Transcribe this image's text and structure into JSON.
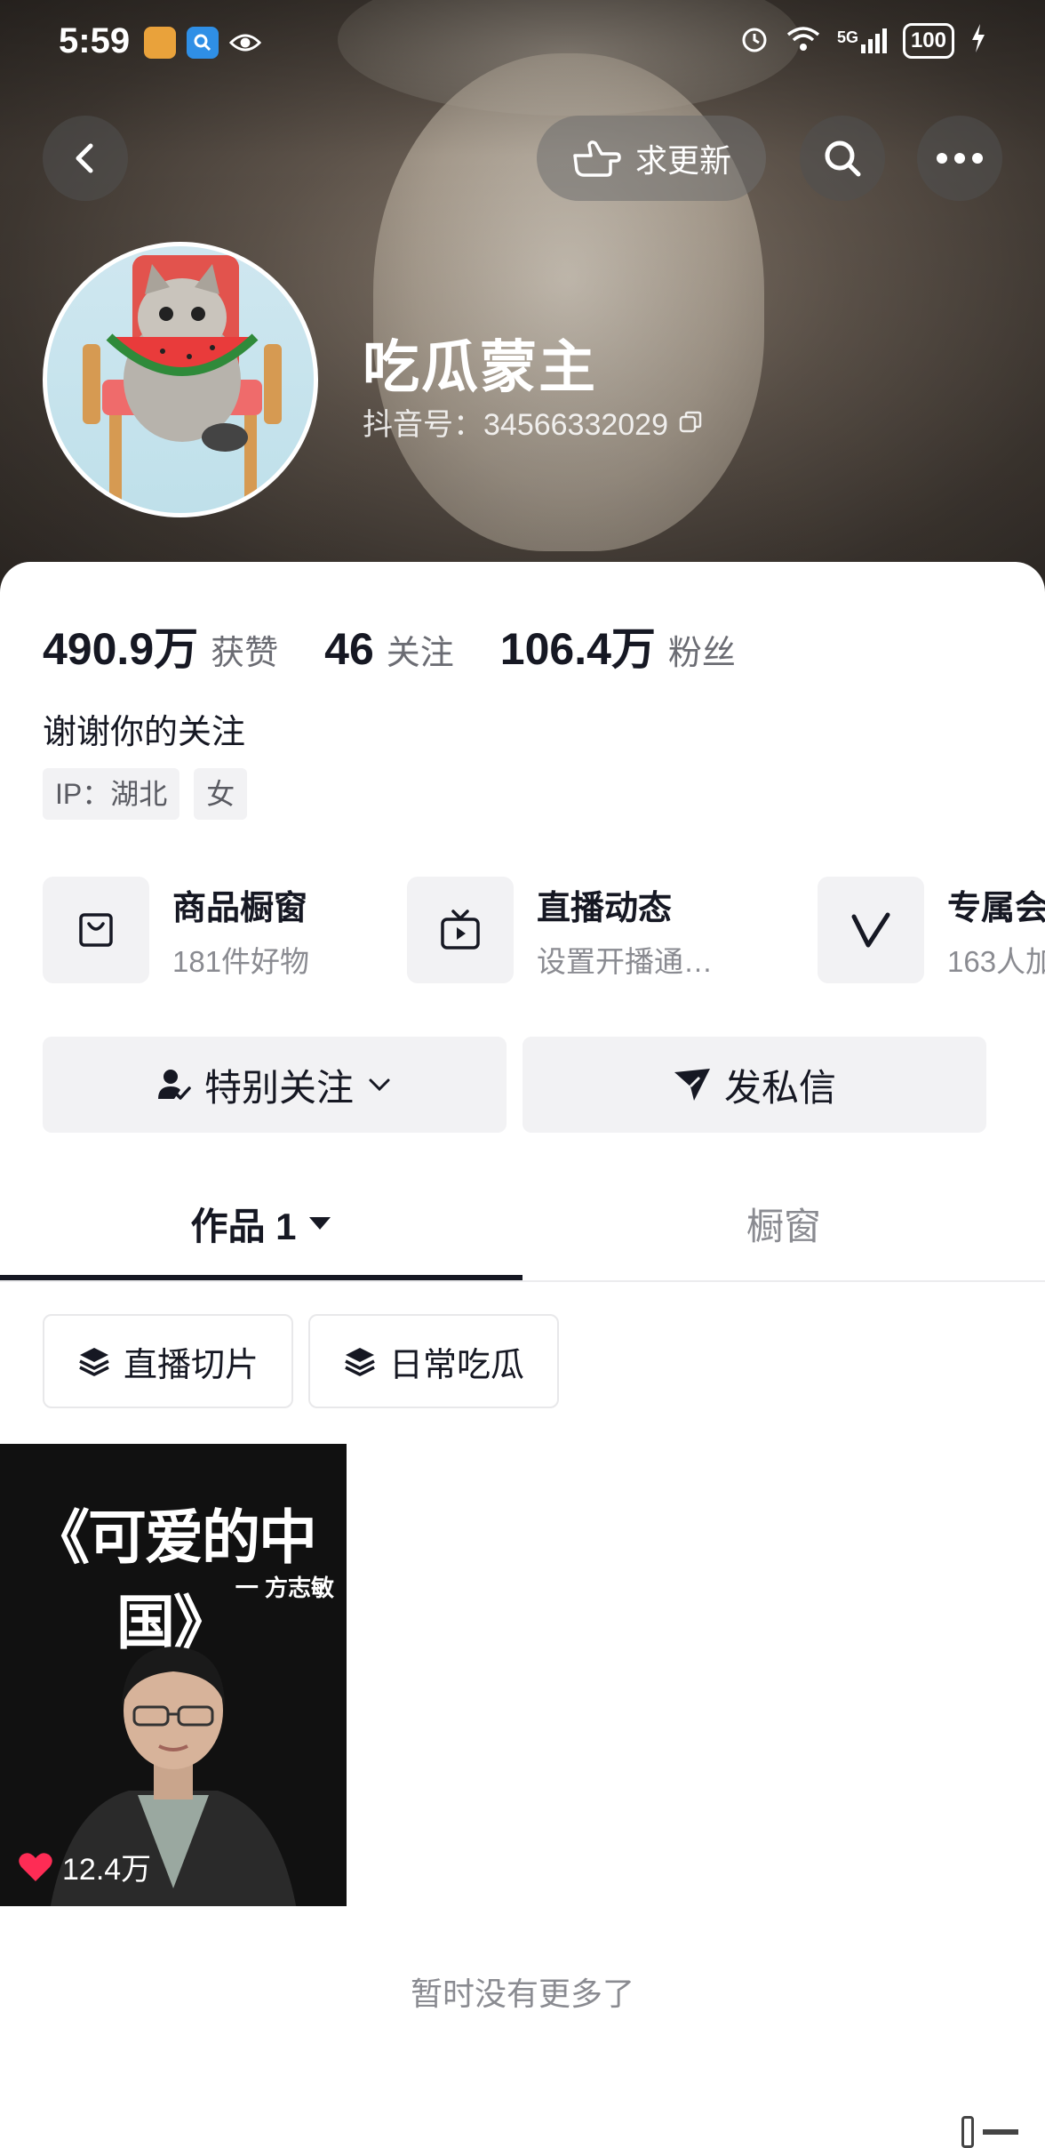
{
  "status_bar": {
    "time": "5:59",
    "network": "5G",
    "battery": "100"
  },
  "top_bar": {
    "request_update_label": "求更新"
  },
  "profile": {
    "nickname": "吃瓜蒙主",
    "douyin_id": "抖音号：34566332029",
    "stats": [
      {
        "value": "490.9万",
        "label": "获赞"
      },
      {
        "value": "46",
        "label": "关注"
      },
      {
        "value": "106.4万",
        "label": "粉丝"
      }
    ],
    "bio": "谢谢你的关注",
    "tags": [
      "IP：湖北",
      "女"
    ]
  },
  "features": [
    {
      "icon": "shopping-bag-icon",
      "title": "商品橱窗",
      "subtitle": "181件好物"
    },
    {
      "icon": "tv-play-icon",
      "title": "直播动态",
      "subtitle": "设置开播通…"
    },
    {
      "icon": "v-badge-icon",
      "title": "专属会",
      "subtitle": "163人加"
    }
  ],
  "actions": {
    "follow_label": "特别关注",
    "message_label": "发私信"
  },
  "tabs": {
    "works_label": "作品 1",
    "showcase_label": "橱窗"
  },
  "collections": [
    "直播切片",
    "日常吃瓜"
  ],
  "video": {
    "title": "《可爱的中国》",
    "subtitle": "一 方志敏",
    "likes": "12.4万"
  },
  "footer": {
    "no_more": "暂时没有更多了"
  },
  "colors": {
    "accent_red": "#fe2c55",
    "text_primary": "#161823",
    "text_secondary": "#8a8b91",
    "chip_bg": "#f2f2f4"
  }
}
